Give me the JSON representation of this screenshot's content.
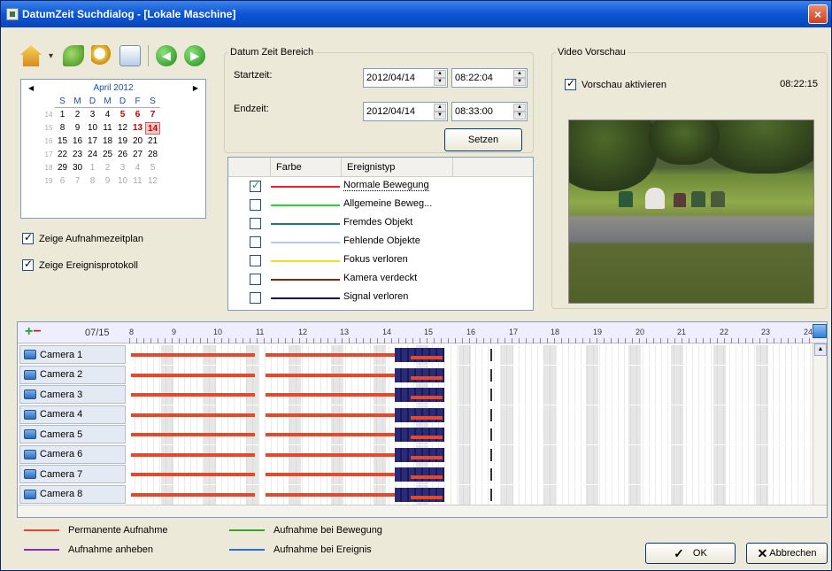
{
  "window": {
    "title": "DatumZeit Suchdialog - [Lokale Maschine]",
    "close_glyph": "×"
  },
  "toolbar": {
    "icons": [
      "home-icon",
      "leaf-icon",
      "zoom-icon",
      "list-icon",
      "prev-icon",
      "next-icon"
    ],
    "prev_glyph": "◀",
    "next_glyph": "▶"
  },
  "calendar": {
    "month": "April 2012",
    "dow": [
      "S",
      "M",
      "D",
      "M",
      "D",
      "F",
      "S"
    ],
    "weeks": [
      {
        "wk": "14",
        "days": [
          "1",
          "2",
          "3",
          "4",
          "5",
          "6",
          "7"
        ]
      },
      {
        "wk": "15",
        "days": [
          "8",
          "9",
          "10",
          "11",
          "12",
          "13",
          "14"
        ]
      },
      {
        "wk": "16",
        "days": [
          "15",
          "16",
          "17",
          "18",
          "19",
          "20",
          "21"
        ]
      },
      {
        "wk": "17",
        "days": [
          "22",
          "23",
          "24",
          "25",
          "26",
          "27",
          "28"
        ]
      },
      {
        "wk": "18",
        "days": [
          "29",
          "30",
          "1",
          "2",
          "3",
          "4",
          "5"
        ]
      },
      {
        "wk": "19",
        "days": [
          "6",
          "7",
          "8",
          "9",
          "10",
          "11",
          "12"
        ]
      }
    ]
  },
  "options": {
    "show_schedule": "Zeige Aufnahmezeitplan",
    "show_eventlog": "Zeige Ereignisprotokoll"
  },
  "range": {
    "legend": "Datum Zeit Bereich",
    "start_label": "Startzeit:",
    "start_date": "2012/04/14",
    "start_time": "08:22:04",
    "end_label": "Endzeit:",
    "end_date": "2012/04/14",
    "end_time": "08:33:00",
    "set_button": "Setzen"
  },
  "events": {
    "col_color": "Farbe",
    "col_type": "Ereignistyp",
    "rows": [
      {
        "label": "Normale Bewegung",
        "color": "#e8232a",
        "checked": true
      },
      {
        "label": "Allgemeine Beweg...",
        "color": "#22dd22",
        "checked": false
      },
      {
        "label": "Fremdes Objekt",
        "color": "#1a7a7a",
        "checked": false
      },
      {
        "label": "Fehlende Objekte",
        "color": "#b8c8f0",
        "checked": false
      },
      {
        "label": "Fokus verloren",
        "color": "#f0e020",
        "checked": false
      },
      {
        "label": "Kamera verdeckt",
        "color": "#7a2a10",
        "checked": false
      },
      {
        "label": "Signal verloren",
        "color": "#10104a",
        "checked": false
      }
    ]
  },
  "video": {
    "legend": "Video Vorschau",
    "enable_label": "Vorschau aktivieren",
    "time": "08:22:15"
  },
  "timeline": {
    "date": "07/15",
    "hours": [
      "8",
      "9",
      "10",
      "11",
      "12",
      "13",
      "14",
      "15",
      "16",
      "17",
      "18",
      "19",
      "20",
      "21",
      "22",
      "23",
      "24"
    ],
    "cameras": [
      "Camera 1",
      "Camera 2",
      "Camera 3",
      "Camera 4",
      "Camera 5",
      "Camera 6",
      "Camera 7",
      "Camera 8"
    ]
  },
  "legend": {
    "permanent": "Permanente Aufnahme",
    "motion": "Aufnahme bei Bewegung",
    "boost": "Aufnahme anheben",
    "event": "Aufnahme bei Ereignis",
    "colors": {
      "permanent": "#e8482a",
      "motion": "#3aa02a",
      "boost": "#8a2ac0",
      "event": "#2a6ae8"
    }
  },
  "buttons": {
    "ok": "OK",
    "cancel": "Abbrechen",
    "ok_glyph": "✓",
    "cancel_glyph": "✕"
  }
}
